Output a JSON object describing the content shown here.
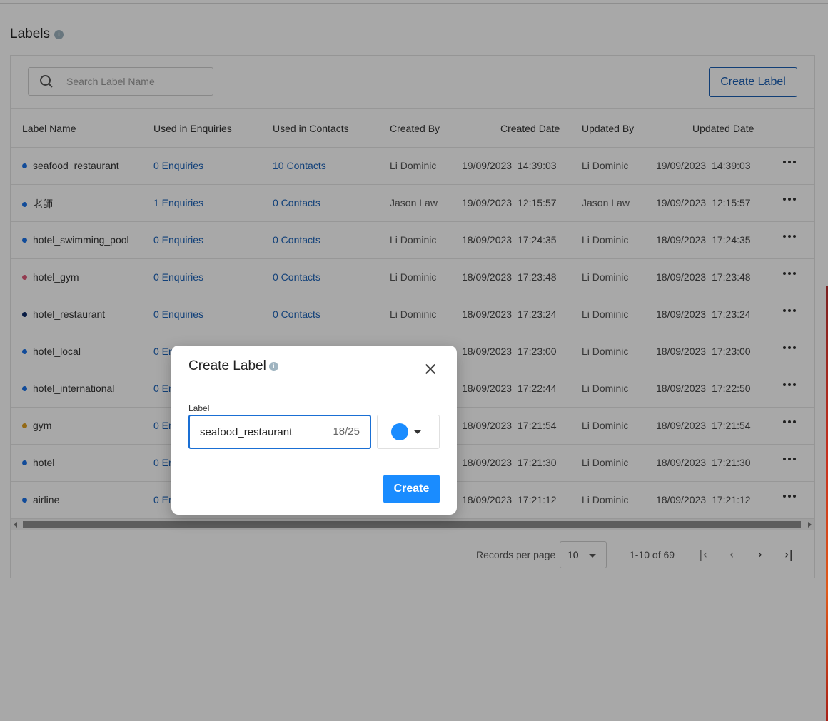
{
  "page": {
    "title": "Labels"
  },
  "search": {
    "placeholder": "Search Label Name"
  },
  "toolbar": {
    "create_label": "Create Label"
  },
  "table": {
    "columns": {
      "label_name": "Label Name",
      "used_in_enquiries": "Used in Enquiries",
      "used_in_contacts": "Used in Contacts",
      "created_by": "Created By",
      "created_date": "Created Date",
      "updated_by": "Updated By",
      "updated_date": "Updated Date"
    },
    "rows": [
      {
        "name": "seafood_restaurant",
        "color": "#1a73e8",
        "enquiries": "0 Enquiries",
        "contacts": "10 Contacts",
        "created_by": "Li Dominic",
        "created_date": "19/09/2023",
        "created_time": "14:39:03",
        "updated_by": "Li Dominic",
        "updated_date": "19/09/2023",
        "updated_time": "14:39:03"
      },
      {
        "name": "老師",
        "color": "#1a73e8",
        "enquiries": "1 Enquiries",
        "contacts": "0 Contacts",
        "created_by": "Jason Law",
        "created_date": "19/09/2023",
        "created_time": "12:15:57",
        "updated_by": "Jason Law",
        "updated_date": "19/09/2023",
        "updated_time": "12:15:57"
      },
      {
        "name": "hotel_swimming_pool",
        "color": "#1a73e8",
        "enquiries": "0 Enquiries",
        "contacts": "0 Contacts",
        "created_by": "Li Dominic",
        "created_date": "18/09/2023",
        "created_time": "17:24:35",
        "updated_by": "Li Dominic",
        "updated_date": "18/09/2023",
        "updated_time": "17:24:35"
      },
      {
        "name": "hotel_gym",
        "color": "#e05a7a",
        "enquiries": "0 Enquiries",
        "contacts": "0 Contacts",
        "created_by": "Li Dominic",
        "created_date": "18/09/2023",
        "created_time": "17:23:48",
        "updated_by": "Li Dominic",
        "updated_date": "18/09/2023",
        "updated_time": "17:23:48"
      },
      {
        "name": "hotel_restaurant",
        "color": "#0d2a66",
        "enquiries": "0 Enquiries",
        "contacts": "0 Contacts",
        "created_by": "Li Dominic",
        "created_date": "18/09/2023",
        "created_time": "17:23:24",
        "updated_by": "Li Dominic",
        "updated_date": "18/09/2023",
        "updated_time": "17:23:24"
      },
      {
        "name": "hotel_local",
        "color": "#1a73e8",
        "enquiries": "0 Enquiries",
        "contacts": "",
        "created_by": "",
        "created_date": "18/09/2023",
        "created_time": "17:23:00",
        "updated_by": "Li Dominic",
        "updated_date": "18/09/2023",
        "updated_time": "17:23:00"
      },
      {
        "name": "hotel_international",
        "color": "#1a73e8",
        "enquiries": "0 Enquiries",
        "contacts": "",
        "created_by": "",
        "created_date": "18/09/2023",
        "created_time": "17:22:44",
        "updated_by": "Li Dominic",
        "updated_date": "18/09/2023",
        "updated_time": "17:22:50"
      },
      {
        "name": "gym",
        "color": "#e0a020",
        "enquiries": "0 Enquiries",
        "contacts": "",
        "created_by": "",
        "created_date": "18/09/2023",
        "created_time": "17:21:54",
        "updated_by": "Li Dominic",
        "updated_date": "18/09/2023",
        "updated_time": "17:21:54"
      },
      {
        "name": "hotel",
        "color": "#1a73e8",
        "enquiries": "0 Enquiries",
        "contacts": "",
        "created_by": "",
        "created_date": "18/09/2023",
        "created_time": "17:21:30",
        "updated_by": "Li Dominic",
        "updated_date": "18/09/2023",
        "updated_time": "17:21:30"
      },
      {
        "name": "airline",
        "color": "#1a73e8",
        "enquiries": "0 Enquiries",
        "contacts": "",
        "created_by": "",
        "created_date": "18/09/2023",
        "created_time": "17:21:12",
        "updated_by": "Li Dominic",
        "updated_date": "18/09/2023",
        "updated_time": "17:21:12"
      }
    ]
  },
  "pager": {
    "records_per_page_label": "Records per page",
    "records_per_page": "10",
    "range": "1-10 of 69"
  },
  "modal": {
    "title": "Create Label",
    "field_label": "Label",
    "value": "seafood_restaurant",
    "counter": "18/25",
    "selected_color": "#1a8cff",
    "submit": "Create"
  }
}
